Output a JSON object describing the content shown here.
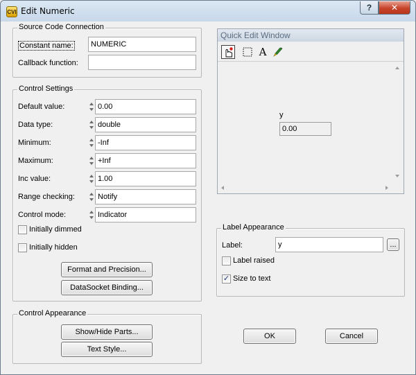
{
  "window": {
    "title": "Edit Numeric",
    "help_label": "?",
    "close_label": "✕",
    "app_icon": "cvi-app-icon"
  },
  "source_code": {
    "legend": "Source Code Connection",
    "constant_name_label": "Constant name:",
    "constant_name_value": "NUMERIC",
    "callback_label": "Callback function:",
    "callback_value": ""
  },
  "control_settings": {
    "legend": "Control Settings",
    "rows": [
      {
        "label": "Default value:",
        "value": "0.00"
      },
      {
        "label": "Data type:",
        "value": "double"
      },
      {
        "label": "Minimum:",
        "value": "-Inf"
      },
      {
        "label": "Maximum:",
        "value": "+Inf"
      },
      {
        "label": "Inc value:",
        "value": "1.00"
      },
      {
        "label": "Range checking:",
        "value": "Notify"
      },
      {
        "label": "Control mode:",
        "value": "Indicator"
      }
    ],
    "initially_dimmed_label": "Initially dimmed",
    "initially_dimmed_checked": false,
    "initially_hidden_label": "Initially hidden",
    "initially_hidden_checked": false,
    "format_button": "Format and Precision...",
    "datasocket_button": "DataSocket Binding..."
  },
  "control_appearance": {
    "legend": "Control Appearance",
    "show_hide_button": "Show/Hide Parts...",
    "text_style_button": "Text Style..."
  },
  "quick_edit": {
    "title": "Quick Edit Window",
    "tools": [
      "operate-tool-icon",
      "select-tool-icon",
      "text-tool-icon",
      "color-tool-icon"
    ],
    "text_tool_glyph": "A",
    "preview_label": "y",
    "preview_value": "0.00"
  },
  "label_appearance": {
    "legend": "Label Appearance",
    "label_label": "Label:",
    "label_value": "y",
    "browse_label": "...",
    "label_raised_label": "Label raised",
    "label_raised_checked": false,
    "size_to_text_label": "Size to text",
    "size_to_text_checked": true
  },
  "dialog_buttons": {
    "ok": "OK",
    "cancel": "Cancel"
  }
}
